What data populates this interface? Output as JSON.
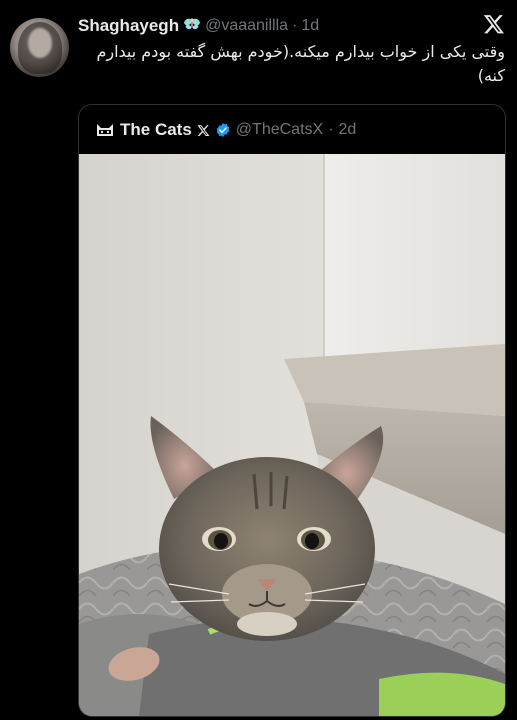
{
  "author": {
    "name": "Shaghayegh",
    "handle": "@vaaanillla",
    "separator": "·",
    "time": "1d",
    "emoji_icon": "fairy-icon"
  },
  "tweet": {
    "text": "وقتی یکی از خواب بیدارم میکنه.(خودم بهش گفته بودم بیدارم کنه)"
  },
  "quoted": {
    "name": "The Cats",
    "handle": "@TheCatsX",
    "separator": "·",
    "time": "2d",
    "verified": true,
    "avatar_icon": "cat-logo-icon"
  },
  "colors": {
    "background": "#000000",
    "text": "#e7e9ea",
    "secondary": "#71767b",
    "border": "#2f3336",
    "verified": "#1d9bf0"
  }
}
